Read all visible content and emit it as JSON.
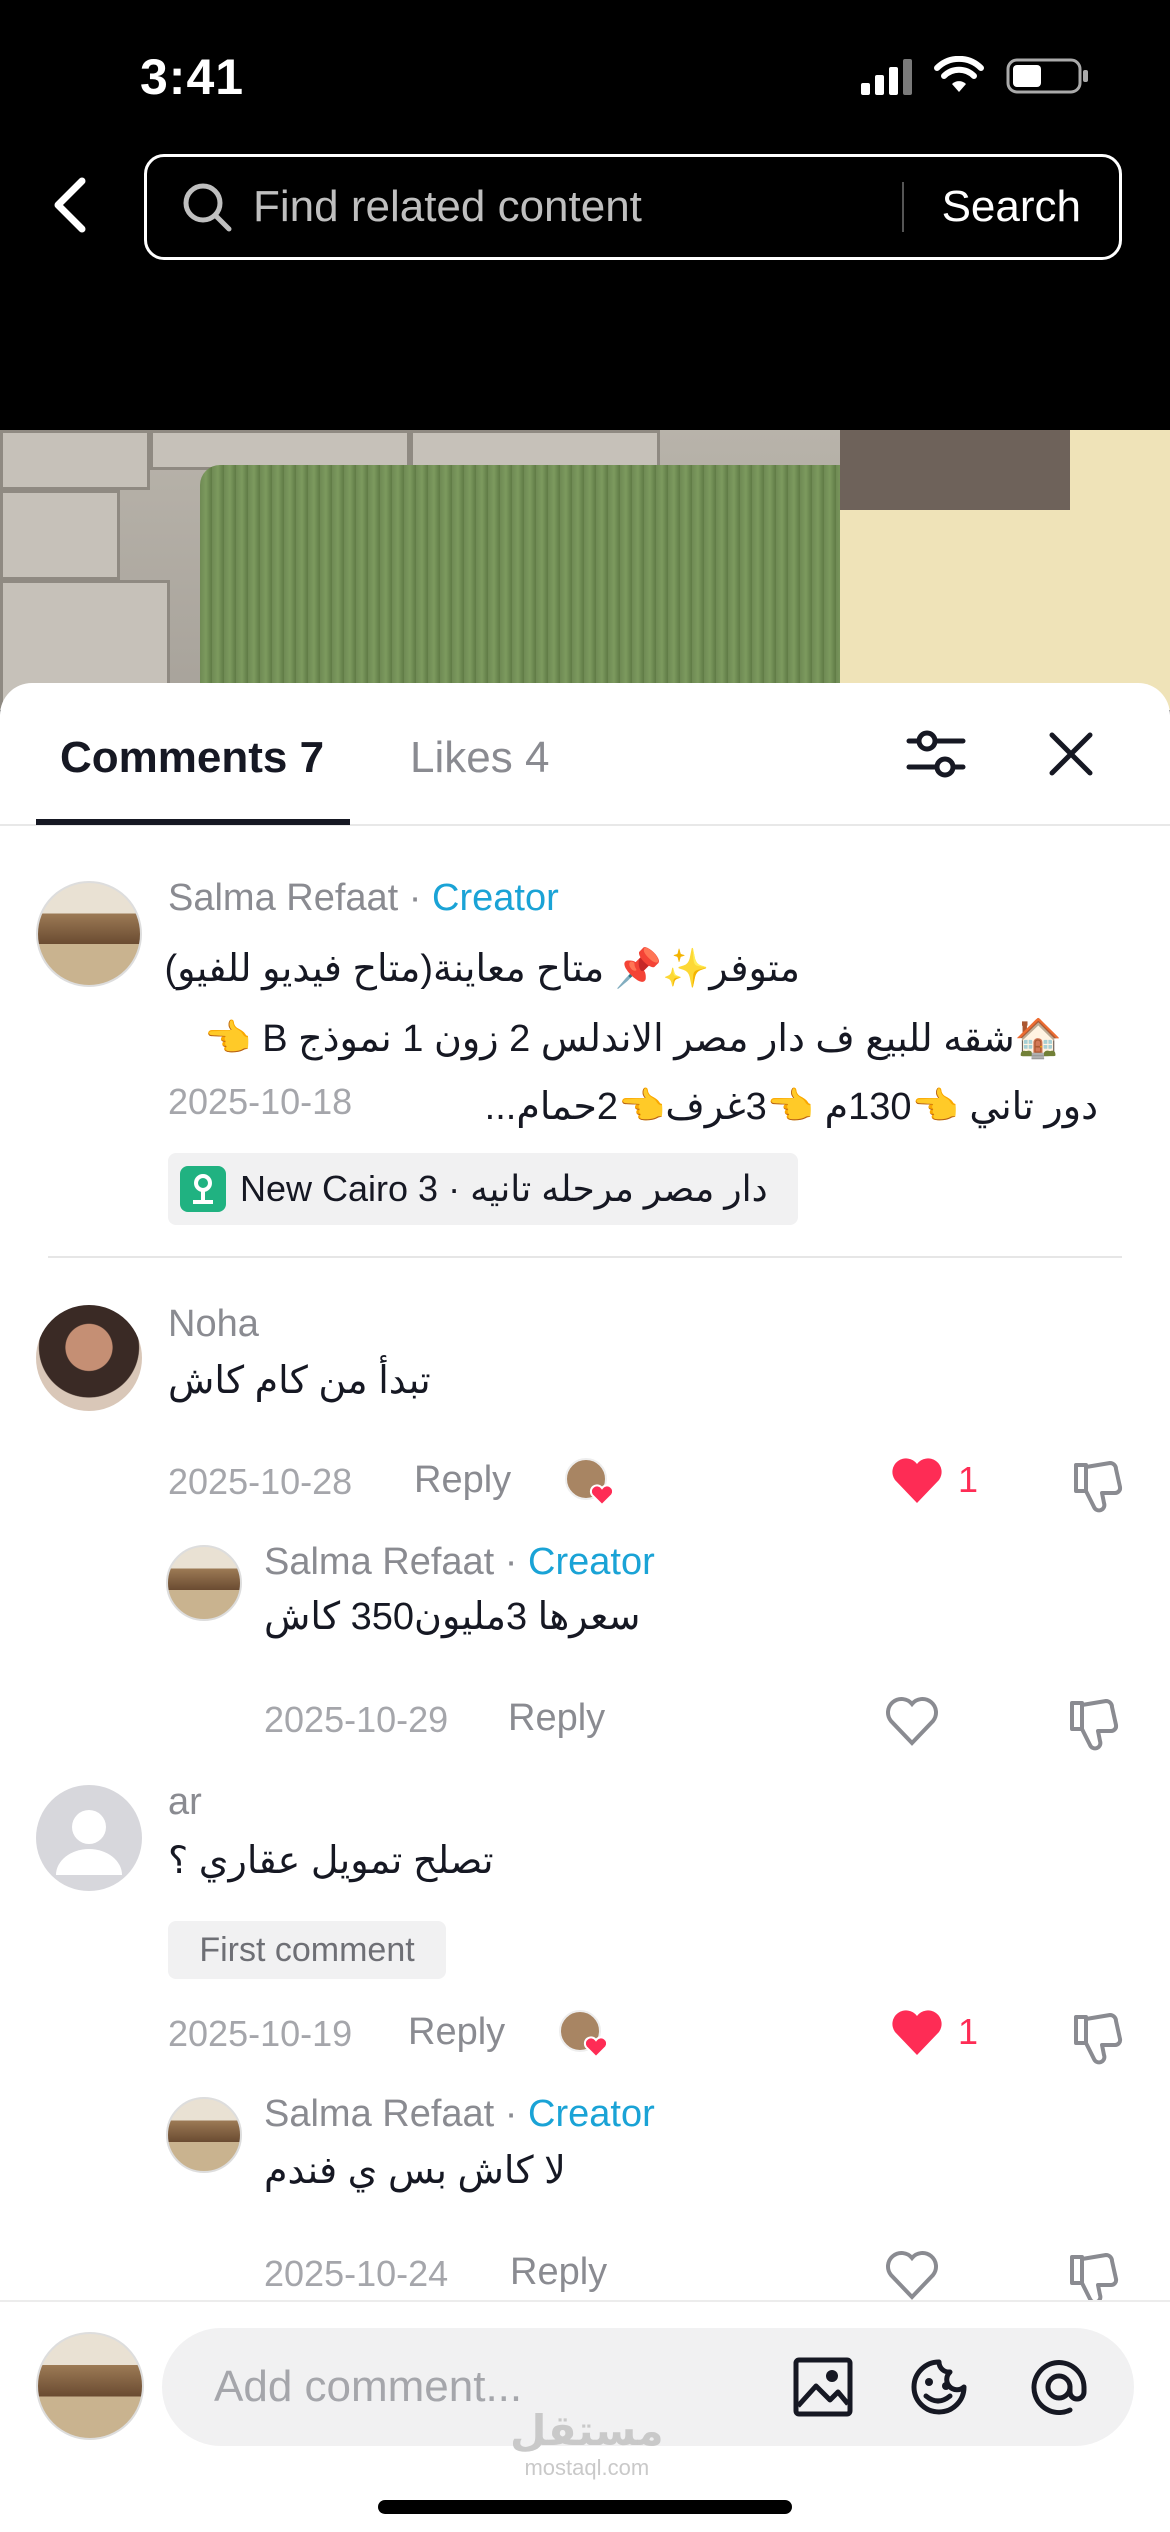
{
  "status": {
    "time": "3:41"
  },
  "search": {
    "placeholder": "Find related content",
    "button": "Search"
  },
  "tabs": {
    "comments": "Comments 7",
    "likes": "Likes 4"
  },
  "comments": [
    {
      "author": "Salma Refaat",
      "separator": " · ",
      "badge": "Creator",
      "lines": [
        "متوفر✨📌 متاح معاينة(متاح فيديو للفيو)",
        "🏠شقه للبيع ف دار مصر الاندلس 2 زون 1 نموذج B 👈",
        "دور تاني 👈130م 👈3غرف👈2حمام..."
      ],
      "date": "2025-10-18",
      "location": "New Cairo 3 · دار مصر مرحله تانيه"
    },
    {
      "author": "Noha",
      "text": "تبدأ من كام كاش",
      "date": "2025-10-28",
      "reply": "Reply",
      "likes": "1"
    },
    {
      "author": "Salma Refaat",
      "separator": " · ",
      "badge": "Creator",
      "text": "سعرها 3مليون350 كاش",
      "date": "2025-10-29",
      "reply": "Reply"
    },
    {
      "author": "ar",
      "text": "تصلح تمويل عقاري ؟",
      "badge_label": "First comment",
      "date": "2025-10-19",
      "reply": "Reply",
      "likes": "1"
    },
    {
      "author": "Salma Refaat",
      "separator": " · ",
      "badge": "Creator",
      "text": "لا كاش بس ي فندم",
      "date": "2025-10-24",
      "reply": "Reply"
    }
  ],
  "input": {
    "placeholder": "Add comment..."
  },
  "watermark": {
    "main": "مستقل",
    "sub": "mostaql.com"
  },
  "colors": {
    "creator": "#1aa3d6",
    "like": "#fe2c55",
    "text": "#161823",
    "muted": "#8a8b91"
  },
  "icons": [
    "back-arrow-icon",
    "search-icon",
    "filter-icon",
    "close-icon",
    "heart-icon",
    "dislike-icon",
    "image-icon",
    "emoji-icon",
    "mention-icon",
    "location-icon"
  ]
}
